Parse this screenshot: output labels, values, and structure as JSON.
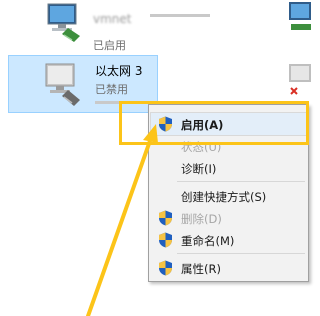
{
  "adapters": [
    {
      "name": "vmnet",
      "status": "已启用"
    },
    {
      "name": "以太网 3",
      "status": "已禁用"
    }
  ],
  "context_menu": {
    "items": [
      {
        "label": "启用(A)",
        "enabled": true,
        "shield": true
      },
      {
        "label": "状态(U)",
        "enabled": false,
        "shield": false
      },
      {
        "label": "诊断(I)",
        "enabled": true,
        "shield": false
      },
      {
        "label": "创建快捷方式(S)",
        "enabled": true,
        "shield": false
      },
      {
        "label": "删除(D)",
        "enabled": false,
        "shield": true
      },
      {
        "label": "重命名(M)",
        "enabled": true,
        "shield": true
      },
      {
        "label": "属性(R)",
        "enabled": true,
        "shield": true
      }
    ]
  },
  "colors": {
    "annotation": "#fcc419",
    "selection": "#cce8ff",
    "menu_bg": "#f2f2f2"
  }
}
